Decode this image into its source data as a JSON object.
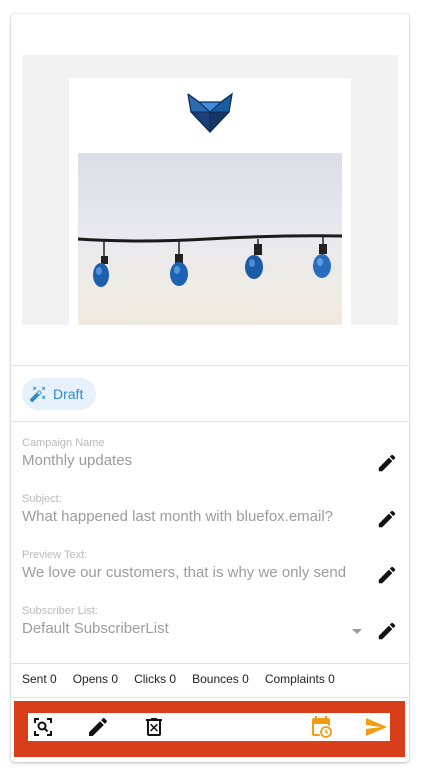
{
  "campaign": {
    "status": "Draft",
    "fields": [
      {
        "label": "Campaign Name",
        "value": "Monthly updates"
      },
      {
        "label": "Subject:",
        "value": "What happened last month with bluefox.email?"
      },
      {
        "label": "Preview Text:",
        "value": "We love our customers, that is why we only send"
      },
      {
        "label": "Subscriber List:",
        "value": "Default SubscriberList"
      }
    ]
  },
  "stats": [
    {
      "label": "Sent",
      "value": "0",
      "text": "Sent 0"
    },
    {
      "label": "Opens",
      "value": "0",
      "text": "Opens 0"
    },
    {
      "label": "Clicks",
      "value": "0",
      "text": "Clicks 0"
    },
    {
      "label": "Bounces",
      "value": "0",
      "text": "Bounces 0"
    },
    {
      "label": "Complaints",
      "value": "0",
      "text": "Complaints 0"
    }
  ],
  "icons": {
    "status": "magic-wand-icon",
    "edit": "pencil-icon",
    "preview": "zoom-scan-icon",
    "delete": "trash-icon",
    "schedule": "calendar-clock-icon",
    "send": "send-icon",
    "logo": "bluefox-logo"
  },
  "colors": {
    "accent": "#2a8bd6",
    "chip_bg": "#e6f1fb",
    "action_bar": "#d93e1a",
    "schedule": "#f39c12",
    "send": "#f39c12"
  }
}
